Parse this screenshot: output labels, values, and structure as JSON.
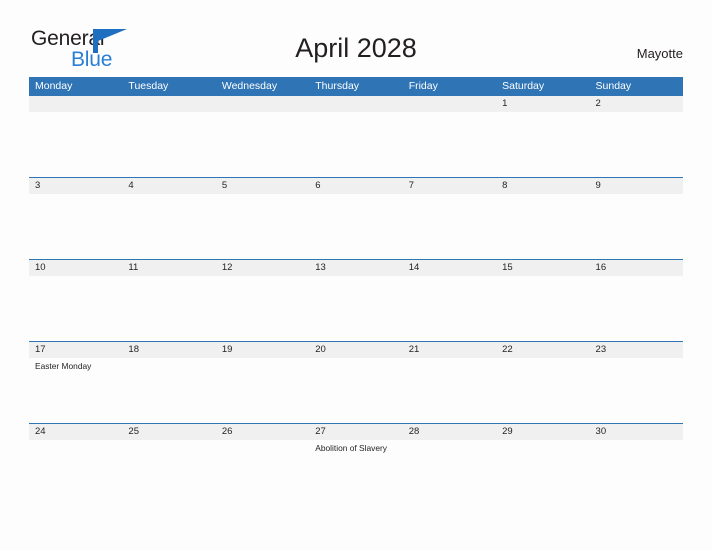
{
  "brand": {
    "name_part1": "General",
    "name_part2": "Blue",
    "mark_icon": "flag-triangle-icon",
    "accent_color": "#2a7fd4"
  },
  "header": {
    "title": "April 2028",
    "location": "Mayotte"
  },
  "theme": {
    "header_blue": "#2f74b5",
    "row_band_gray": "#f0f0f0",
    "page_background": "#fdfdfe",
    "text_color": "#231f20"
  },
  "calendar": {
    "month": "April",
    "year": "2028",
    "day_headers": [
      "Monday",
      "Tuesday",
      "Wednesday",
      "Thursday",
      "Friday",
      "Saturday",
      "Sunday"
    ],
    "weeks": [
      {
        "days": [
          {
            "number": "",
            "event": ""
          },
          {
            "number": "",
            "event": ""
          },
          {
            "number": "",
            "event": ""
          },
          {
            "number": "",
            "event": ""
          },
          {
            "number": "",
            "event": ""
          },
          {
            "number": "1",
            "event": ""
          },
          {
            "number": "2",
            "event": ""
          }
        ]
      },
      {
        "days": [
          {
            "number": "3",
            "event": ""
          },
          {
            "number": "4",
            "event": ""
          },
          {
            "number": "5",
            "event": ""
          },
          {
            "number": "6",
            "event": ""
          },
          {
            "number": "7",
            "event": ""
          },
          {
            "number": "8",
            "event": ""
          },
          {
            "number": "9",
            "event": ""
          }
        ]
      },
      {
        "days": [
          {
            "number": "10",
            "event": ""
          },
          {
            "number": "11",
            "event": ""
          },
          {
            "number": "12",
            "event": ""
          },
          {
            "number": "13",
            "event": ""
          },
          {
            "number": "14",
            "event": ""
          },
          {
            "number": "15",
            "event": ""
          },
          {
            "number": "16",
            "event": ""
          }
        ]
      },
      {
        "days": [
          {
            "number": "17",
            "event": "Easter Monday"
          },
          {
            "number": "18",
            "event": ""
          },
          {
            "number": "19",
            "event": ""
          },
          {
            "number": "20",
            "event": ""
          },
          {
            "number": "21",
            "event": ""
          },
          {
            "number": "22",
            "event": ""
          },
          {
            "number": "23",
            "event": ""
          }
        ]
      },
      {
        "days": [
          {
            "number": "24",
            "event": ""
          },
          {
            "number": "25",
            "event": ""
          },
          {
            "number": "26",
            "event": ""
          },
          {
            "number": "27",
            "event": "Abolition of Slavery"
          },
          {
            "number": "28",
            "event": ""
          },
          {
            "number": "29",
            "event": ""
          },
          {
            "number": "30",
            "event": ""
          }
        ]
      }
    ]
  }
}
